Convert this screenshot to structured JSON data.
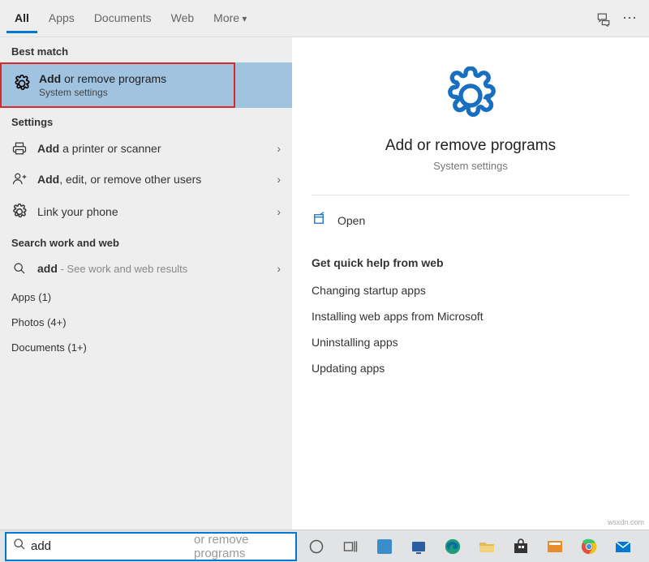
{
  "header": {
    "tabs": {
      "all": "All",
      "apps": "Apps",
      "documents": "Documents",
      "web": "Web",
      "more": "More"
    }
  },
  "results": {
    "bestMatchLabel": "Best match",
    "bestMatch": {
      "bold": "Add",
      "rest": " or remove programs",
      "sub": "System settings"
    },
    "settingsLabel": "Settings",
    "settings": [
      {
        "bold": "Add",
        "rest": " a printer or scanner"
      },
      {
        "bold": "Add",
        "rest": ", edit, or remove other users"
      },
      {
        "plain": "Link your phone"
      }
    ],
    "searchWebLabel": "Search work and web",
    "searchWeb": {
      "bold": "add",
      "hint": " - See work and web results"
    },
    "appsLabel": "Apps (1)",
    "photosLabel": "Photos (4+)",
    "documentsLabel": "Documents (1+)"
  },
  "preview": {
    "title": "Add or remove programs",
    "sub": "System settings",
    "open": "Open",
    "helpTitle": "Get quick help from web",
    "helpLinks": [
      "Changing startup apps",
      "Installing web apps from Microsoft",
      "Uninstalling apps",
      "Updating apps"
    ]
  },
  "taskbar": {
    "searchValue": "add",
    "searchPlaceholder": "add or remove programs"
  },
  "watermark": "wsxdn.com"
}
